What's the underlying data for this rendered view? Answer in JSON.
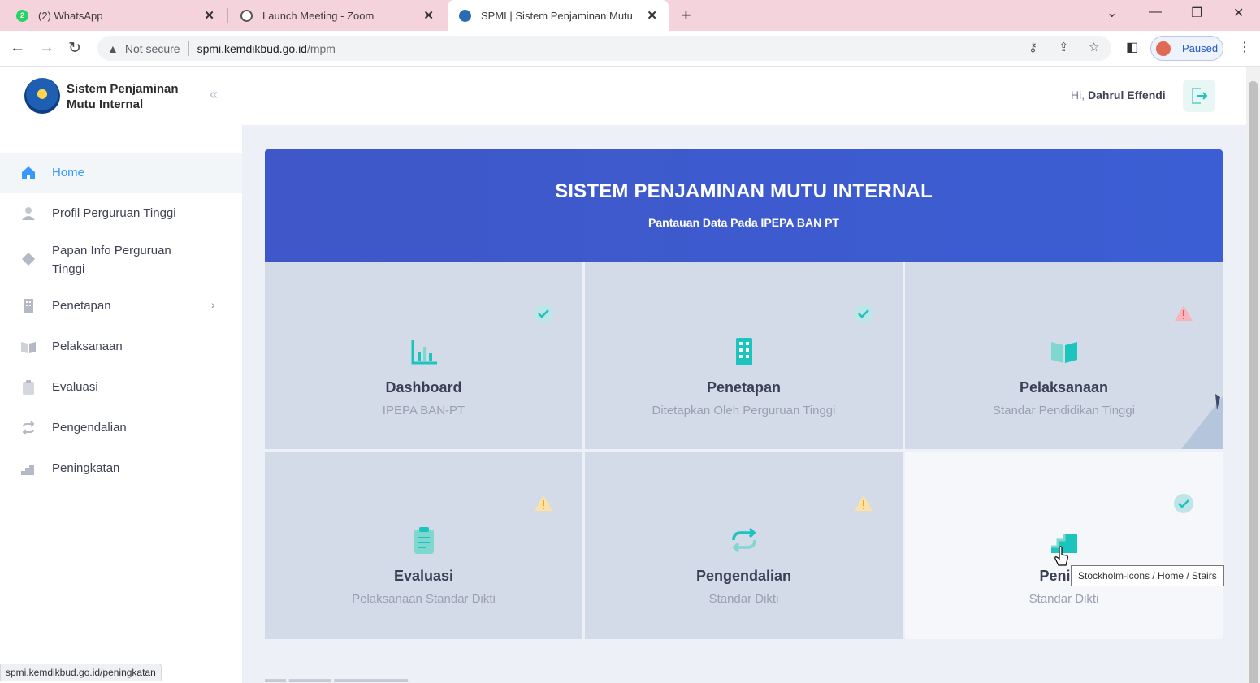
{
  "browser": {
    "tabs": [
      {
        "title": "(2) WhatsApp",
        "favicon": "whatsapp-icon",
        "badge": "2"
      },
      {
        "title": "Launch Meeting - Zoom",
        "favicon": "globe-icon"
      },
      {
        "title": "SPMI | Sistem Penjaminan Mutu",
        "favicon": "kemdikbud-icon"
      }
    ],
    "new_tab": "+",
    "not_secure": "Not secure",
    "url_domain": "spmi.kemdikbud.go.id",
    "url_path": "/mpm",
    "profile_status": "Paused",
    "status_url": "spmi.kemdikbud.go.id/peningkatan"
  },
  "sidebar": {
    "brand_line1": "Sistem Penjaminan",
    "brand_line2": "Mutu Internal",
    "items": [
      {
        "label": "Home",
        "icon": "home-icon"
      },
      {
        "label": "Profil Perguruan Tinggi",
        "icon": "user-icon"
      },
      {
        "label": "Papan Info Perguruan Tinggi",
        "icon": "diamond-icon"
      },
      {
        "label": "Penetapan",
        "icon": "building-icon"
      },
      {
        "label": "Pelaksanaan",
        "icon": "book-icon"
      },
      {
        "label": "Evaluasi",
        "icon": "clipboard-icon"
      },
      {
        "label": "Pengendalian",
        "icon": "repeat-icon"
      },
      {
        "label": "Peningkatan",
        "icon": "stairs-icon"
      }
    ]
  },
  "header": {
    "greeting": "Hi,",
    "user": "Dahrul Effendi"
  },
  "banner": {
    "title": "SISTEM PENJAMINAN MUTU INTERNAL",
    "subtitle": "Pantauan Data Pada IPEPA BAN PT"
  },
  "cards": [
    {
      "title": "Dashboard",
      "subtitle": "IPEPA BAN-PT",
      "status": "check"
    },
    {
      "title": "Penetapan",
      "subtitle": "Ditetapkan Oleh Perguruan Tinggi",
      "status": "check"
    },
    {
      "title": "Pelaksanaan",
      "subtitle": "Standar Pendidikan Tinggi",
      "status": "warning-red"
    },
    {
      "title": "Evaluasi",
      "subtitle": "Pelaksanaan Standar Dikti",
      "status": "warning"
    },
    {
      "title": "Pengendalian",
      "subtitle": "Standar Dikti",
      "status": "warning"
    },
    {
      "title": "Pening",
      "subtitle": "Standar Dikti",
      "status": "check"
    }
  ],
  "tooltip": "Stockholm-icons / Home / Stairs",
  "colors": {
    "accent": "#3699ff",
    "banner": "#3f57c8",
    "teal": "#1bc5bd",
    "warning": "#ffa800",
    "danger": "#f64e60"
  }
}
